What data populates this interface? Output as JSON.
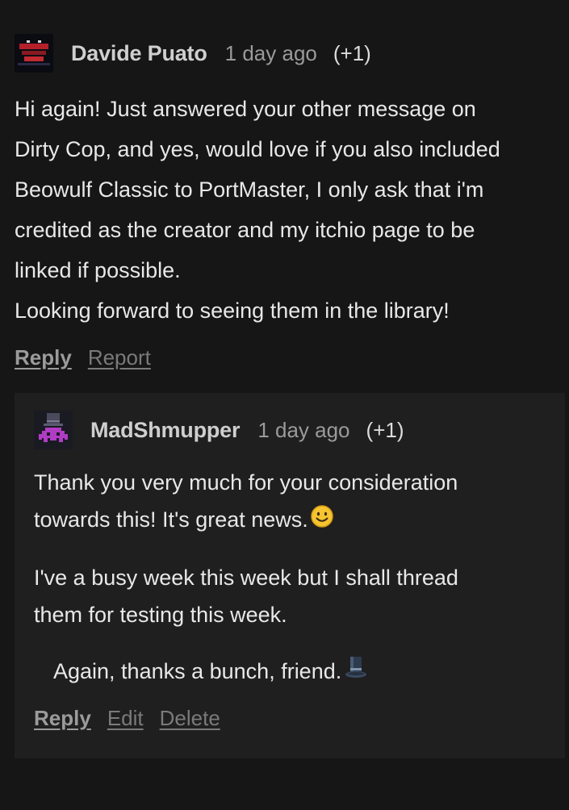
{
  "comment": {
    "author": "Davide Puato",
    "time": "1 day ago",
    "votes": "(+1)",
    "avatar_icon": "game-logo-avatar",
    "lines": [
      "Hi again! Just answered your other message on",
      "Dirty Cop, and yes, would love if you also included",
      "Beowulf Classic to PortMaster, I only ask that i'm",
      "credited as the creator and my itchio page to be",
      "linked if possible.",
      "Looking forward to seeing them in the library!"
    ],
    "actions": {
      "reply": "Reply",
      "report": "Report"
    }
  },
  "reply": {
    "author": "MadShmupper",
    "time": "1 day ago",
    "votes": "(+1)",
    "avatar_icon": "pixel-invader-top-hat-avatar",
    "paragraph1": [
      "Thank you very much for your consideration",
      "towards this! It's great news."
    ],
    "paragraph2": [
      "I've a busy week this week but I shall thread",
      "them for testing this week."
    ],
    "paragraph3": "Again, thanks a bunch, friend.",
    "emoji1": "smiley-face-icon",
    "emoji2": "top-hat-icon",
    "actions": {
      "reply": "Reply",
      "edit": "Edit",
      "delete": "Delete"
    }
  },
  "colors": {
    "page_bg": "#161616",
    "reply_bg": "#1f1f1f",
    "text": "#e8e8e8",
    "meta": "#9a9a9a",
    "link_muted": "#7a7a7a"
  }
}
